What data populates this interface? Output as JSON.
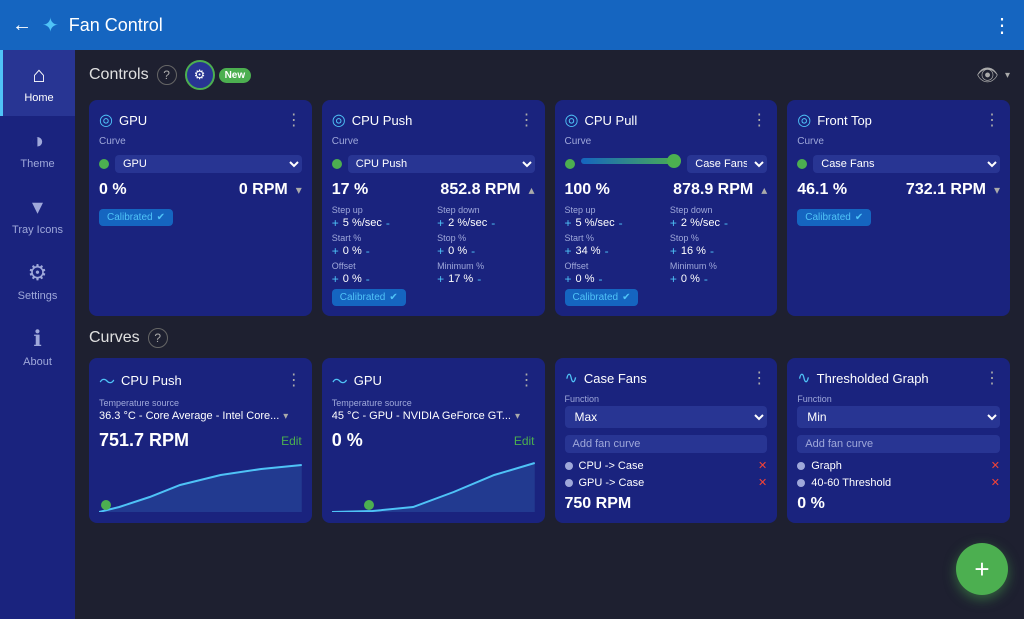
{
  "topbar": {
    "back_icon": "←",
    "fan_icon": "✦",
    "title": "Fan Control",
    "menu_icon": "⋮"
  },
  "sidebar": {
    "items": [
      {
        "id": "home",
        "label": "Home",
        "icon": "⌂",
        "active": true
      },
      {
        "id": "theme",
        "label": "Theme",
        "icon": "◑"
      },
      {
        "id": "tray-icons",
        "label": "Tray Icons",
        "icon": "▾"
      },
      {
        "id": "settings",
        "label": "Settings",
        "icon": "⚙"
      },
      {
        "id": "about",
        "label": "About",
        "icon": "ℹ"
      }
    ]
  },
  "controls": {
    "section_title": "Controls",
    "new_label": "New",
    "cards": [
      {
        "id": "gpu",
        "title": "GPU",
        "curve_label": "Curve",
        "curve_value": "GPU",
        "pct": "0 %",
        "rpm": "0 RPM",
        "rpm_dir": "▾",
        "calibrated": true,
        "has_slider": false,
        "has_detail": false
      },
      {
        "id": "cpu-push",
        "title": "CPU Push",
        "curve_label": "Curve",
        "curve_value": "CPU Push",
        "pct": "17 %",
        "rpm": "852.8 RPM",
        "rpm_dir": "▴",
        "calibrated": true,
        "has_slider": false,
        "has_detail": true,
        "step_up_label": "Step up",
        "step_up_val": "5 %/sec",
        "step_down_label": "Step down",
        "step_down_val": "2 %/sec",
        "start_pct_label": "Start %",
        "start_pct_val": "0 %",
        "stop_pct_label": "Stop %",
        "stop_pct_val": "0 %",
        "offset_label": "Offset",
        "offset_val": "0 %",
        "min_pct_label": "Minimum %",
        "min_pct_val": "17 %"
      },
      {
        "id": "cpu-pull",
        "title": "CPU Pull",
        "curve_label": "Curve",
        "curve_value": "Case Fans",
        "pct": "100 %",
        "rpm": "878.9 RPM",
        "rpm_dir": "▴",
        "calibrated": true,
        "has_slider": true,
        "slider_pct": 100,
        "has_detail": true,
        "step_up_label": "Step up",
        "step_up_val": "5 %/sec",
        "step_down_label": "Step down",
        "step_down_val": "2 %/sec",
        "start_pct_label": "Start %",
        "start_pct_val": "34 %",
        "stop_pct_label": "Stop %",
        "stop_pct_val": "16 %",
        "offset_label": "Offset",
        "offset_val": "0 %",
        "min_pct_label": "Minimum %",
        "min_pct_val": "0 %"
      },
      {
        "id": "front-top",
        "title": "Front Top",
        "curve_label": "Curve",
        "curve_value": "Case Fans",
        "pct": "46.1 %",
        "rpm": "732.1 RPM",
        "rpm_dir": "▾",
        "calibrated": true,
        "has_slider": false,
        "has_detail": false
      }
    ]
  },
  "curves": {
    "section_title": "Curves",
    "cards": [
      {
        "id": "cpu-push-curve",
        "type": "line",
        "title": "CPU Push",
        "source_label": "Temperature source",
        "source_val": "36.3 °C - Core Average - Intel Core...",
        "rpm": "751.7 RPM",
        "edit_label": "Edit"
      },
      {
        "id": "gpu-curve",
        "type": "line",
        "title": "GPU",
        "source_label": "Temperature source",
        "source_val": "45 °C - GPU - NVIDIA GeForce GT...",
        "rpm": "0 %",
        "edit_label": "Edit"
      },
      {
        "id": "case-fans-curve",
        "type": "mix",
        "title": "Case Fans",
        "function_label": "Function",
        "function_val": "Max",
        "add_label": "Add fan curve",
        "items": [
          {
            "label": "CPU -> Case",
            "x_color": "#f44336"
          },
          {
            "label": "GPU -> Case",
            "x_color": "#f44336"
          }
        ],
        "rpm": "750 RPM"
      },
      {
        "id": "thresholded-graph",
        "type": "mix",
        "title": "Thresholded Graph",
        "function_label": "Function",
        "function_val": "Min",
        "add_label": "Add fan curve",
        "items": [
          {
            "label": "Graph",
            "x_color": "#f44336"
          },
          {
            "label": "40-60 Threshold",
            "x_color": "#f44336"
          }
        ],
        "rpm": "0 %"
      }
    ]
  },
  "fab": {
    "icon": "+"
  },
  "calibrated_label": "Calibrated"
}
